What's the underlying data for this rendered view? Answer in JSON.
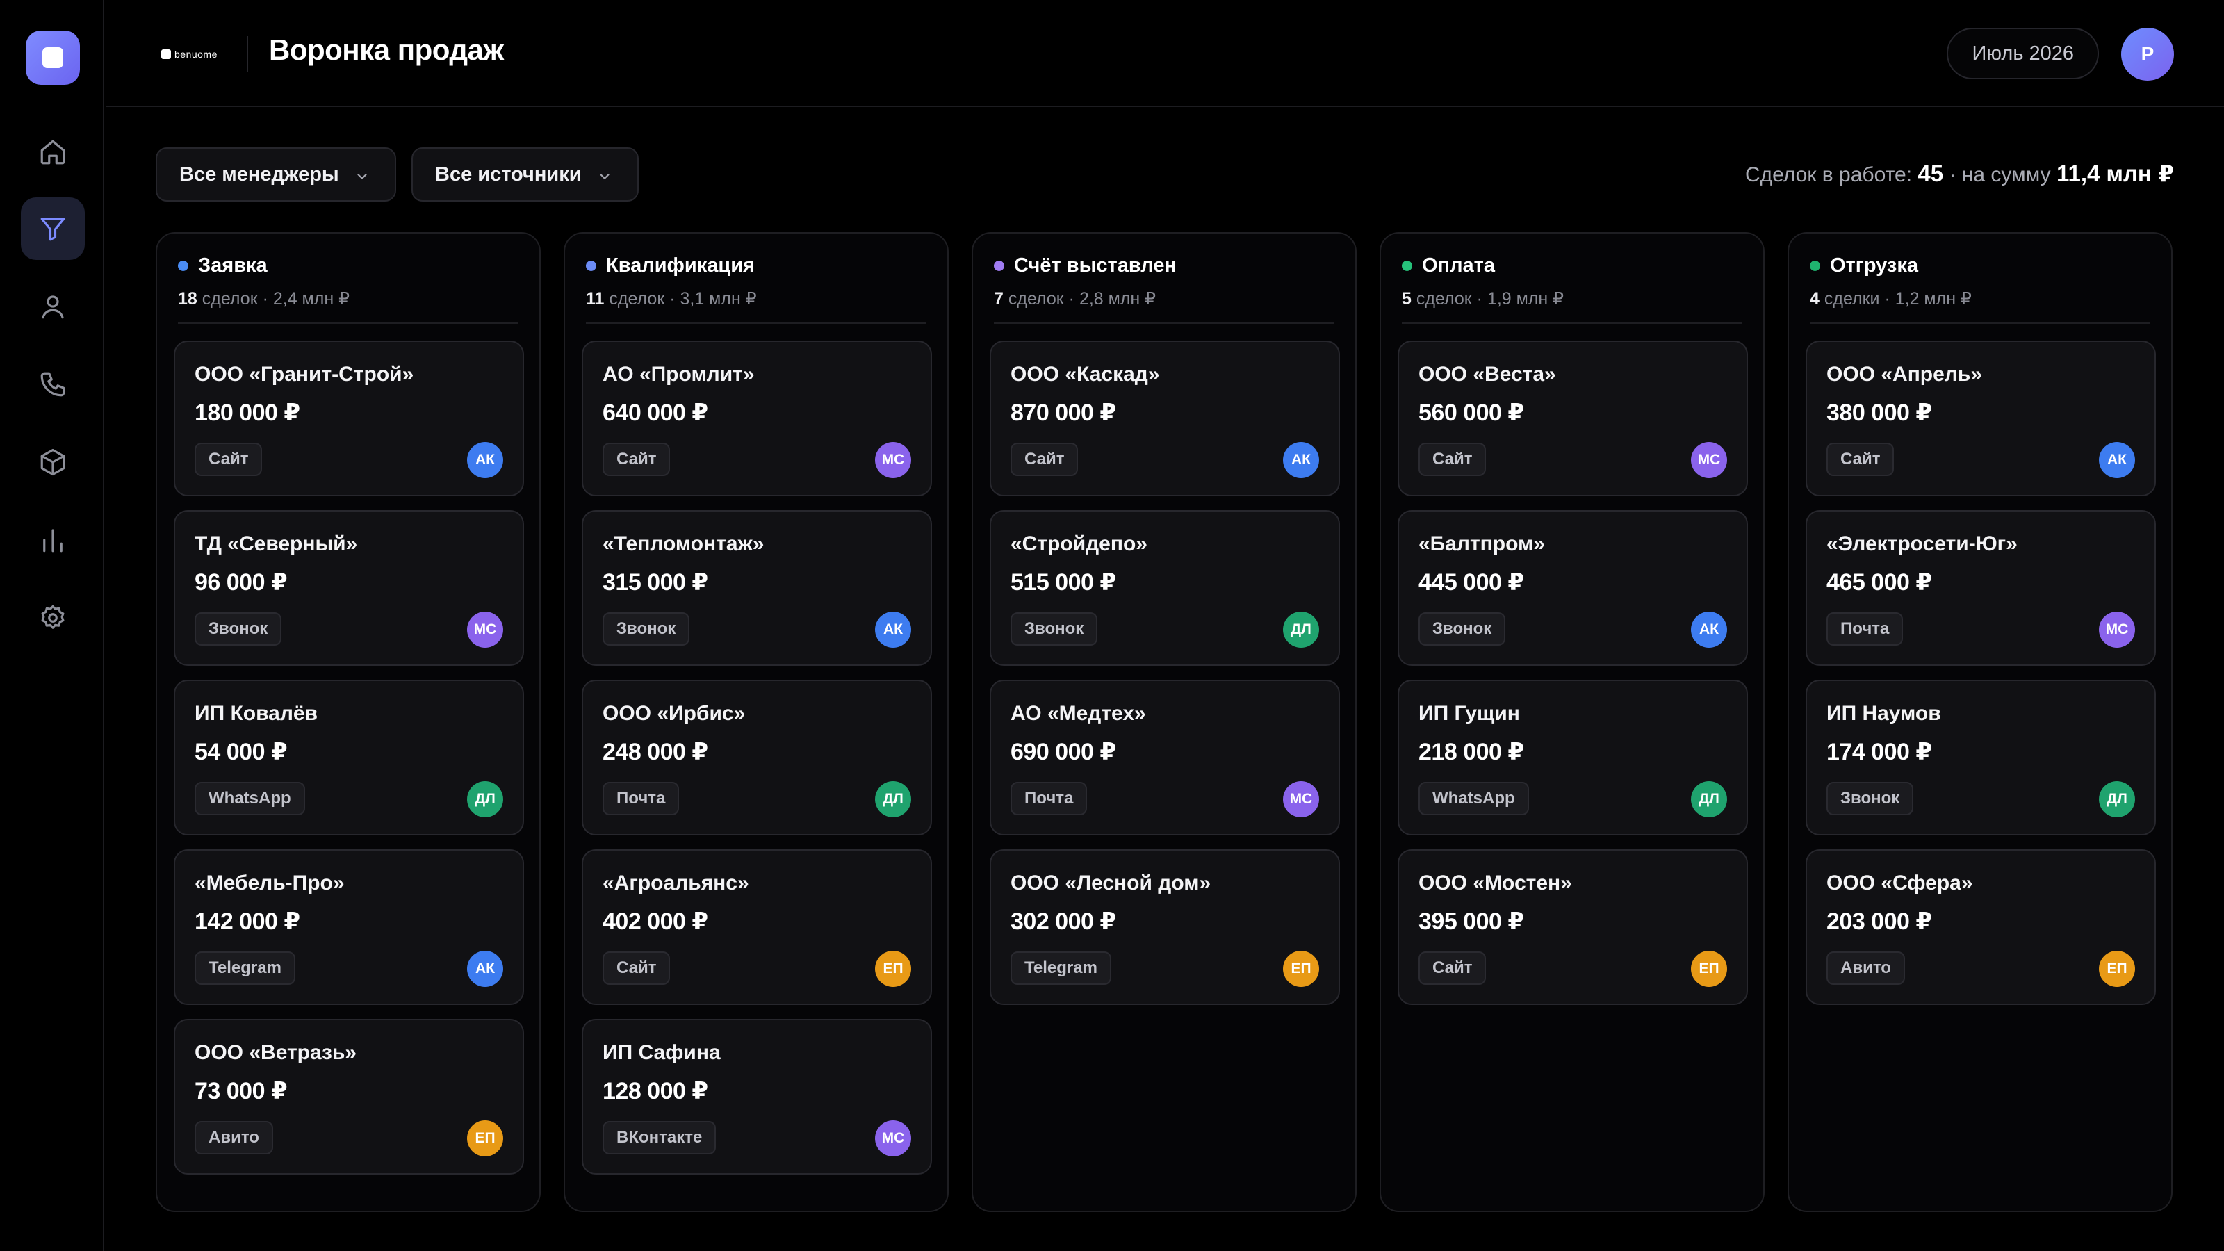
{
  "header": {
    "brand": "benuome",
    "title": "Воронка продаж",
    "month": "Июль 2026",
    "user_initial": "Р"
  },
  "filters": {
    "managers": "Все менеджеры",
    "sources": "Все источники"
  },
  "summary": {
    "prefix": "Сделок в работе:",
    "count": "45",
    "middle": "· на сумму",
    "total": "11,4 млн ₽"
  },
  "managers_colors": {
    "АК": "#3d7cf0",
    "МС": "#8a63ec",
    "ДЛ": "#1fa36e",
    "ЕП": "#e89a16"
  },
  "columns": [
    {
      "title": "Заявка",
      "dot": "#4a8cf4",
      "count": "18",
      "meta": "сделок · 2,4 млн ₽",
      "cards": [
        {
          "name": "ООО «Гранит-Строй»",
          "amount": "180 000 ₽",
          "source": "Сайт",
          "manager": "АК"
        },
        {
          "name": "ТД «Северный»",
          "amount": "96 000 ₽",
          "source": "Звонок",
          "manager": "МС"
        },
        {
          "name": "ИП Ковалёв",
          "amount": "54 000 ₽",
          "source": "WhatsApp",
          "manager": "ДЛ"
        },
        {
          "name": "«Мебель-Про»",
          "amount": "142 000 ₽",
          "source": "Telegram",
          "manager": "АК"
        },
        {
          "name": "ООО «Ветразь»",
          "amount": "73 000 ₽",
          "source": "Авито",
          "manager": "ЕП"
        }
      ]
    },
    {
      "title": "Квалификация",
      "dot": "#6c8cf6",
      "count": "11",
      "meta": "сделок · 3,1 млн ₽",
      "cards": [
        {
          "name": "АО «Промлит»",
          "amount": "640 000 ₽",
          "source": "Сайт",
          "manager": "МС"
        },
        {
          "name": "«Тепломонтаж»",
          "amount": "315 000 ₽",
          "source": "Звонок",
          "manager": "АК"
        },
        {
          "name": "ООО «Ирбис»",
          "amount": "248 000 ₽",
          "source": "Почта",
          "manager": "ДЛ"
        },
        {
          "name": "«Агроальянс»",
          "amount": "402 000 ₽",
          "source": "Сайт",
          "manager": "ЕП"
        },
        {
          "name": "ИП Сафина",
          "amount": "128 000 ₽",
          "source": "ВКонтакте",
          "manager": "МС"
        }
      ]
    },
    {
      "title": "Счёт выставлен",
      "dot": "#a07cf2",
      "count": "7",
      "meta": "сделок · 2,8 млн ₽",
      "cards": [
        {
          "name": "ООО «Каскад»",
          "amount": "870 000 ₽",
          "source": "Сайт",
          "manager": "АК"
        },
        {
          "name": "«Стройдепо»",
          "amount": "515 000 ₽",
          "source": "Звонок",
          "manager": "ДЛ"
        },
        {
          "name": "АО «Медтех»",
          "amount": "690 000 ₽",
          "source": "Почта",
          "manager": "МС"
        },
        {
          "name": "ООО «Лесной дом»",
          "amount": "302 000 ₽",
          "source": "Telegram",
          "manager": "ЕП"
        }
      ]
    },
    {
      "title": "Оплата",
      "dot": "#26c27a",
      "count": "5",
      "meta": "сделок · 1,9 млн ₽",
      "cards": [
        {
          "name": "ООО «Веста»",
          "amount": "560 000 ₽",
          "source": "Сайт",
          "manager": "МС"
        },
        {
          "name": "«Балтпром»",
          "amount": "445 000 ₽",
          "source": "Звонок",
          "manager": "АК"
        },
        {
          "name": "ИП Гущин",
          "amount": "218 000 ₽",
          "source": "WhatsApp",
          "manager": "ДЛ"
        },
        {
          "name": "ООО «Мостен»",
          "amount": "395 000 ₽",
          "source": "Сайт",
          "manager": "ЕП"
        }
      ]
    },
    {
      "title": "Отгрузка",
      "dot": "#1fb36f",
      "count": "4",
      "meta": "сделки · 1,2 млн ₽",
      "cards": [
        {
          "name": "ООО «Апрель»",
          "amount": "380 000 ₽",
          "source": "Сайт",
          "manager": "АК"
        },
        {
          "name": "«Электросети-Юг»",
          "amount": "465 000 ₽",
          "source": "Почта",
          "manager": "МС"
        },
        {
          "name": "ИП Наумов",
          "amount": "174 000 ₽",
          "source": "Звонок",
          "manager": "ДЛ"
        },
        {
          "name": "ООО «Сфера»",
          "amount": "203 000 ₽",
          "source": "Авито",
          "manager": "ЕП"
        }
      ]
    }
  ]
}
